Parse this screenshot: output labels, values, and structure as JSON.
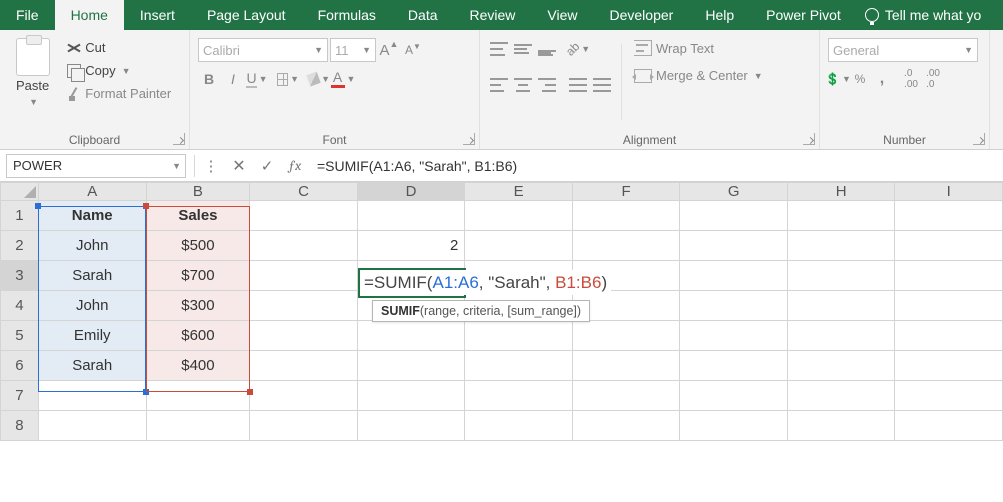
{
  "menu": {
    "file": "File",
    "home": "Home",
    "insert": "Insert",
    "page_layout": "Page Layout",
    "formulas": "Formulas",
    "data": "Data",
    "review": "Review",
    "view": "View",
    "developer": "Developer",
    "help": "Help",
    "power_pivot": "Power Pivot",
    "tell_me": "Tell me what yo"
  },
  "ribbon": {
    "clipboard": {
      "paste": "Paste",
      "cut": "Cut",
      "copy": "Copy",
      "format_painter": "Format Painter",
      "label": "Clipboard"
    },
    "font": {
      "name": "Calibri",
      "size": "11",
      "label": "Font",
      "bold": "B",
      "italic": "I",
      "underline": "U",
      "fontcolor_letter": "A",
      "grow": "A",
      "shrink": "A"
    },
    "alignment": {
      "wrap": "Wrap Text",
      "merge": "Merge & Center",
      "label": "Alignment"
    },
    "number": {
      "format": "General",
      "label": "Number",
      "percent": "%",
      "comma": ","
    }
  },
  "fbar": {
    "namebox": "POWER",
    "formula": "=SUMIF(A1:A6, \"Sarah\", B1:B6)"
  },
  "columns": [
    "A",
    "B",
    "C",
    "D",
    "E",
    "F",
    "G",
    "H",
    "I"
  ],
  "rows": [
    "1",
    "2",
    "3",
    "4",
    "5",
    "6",
    "7",
    "8"
  ],
  "cells": {
    "A1": "Name",
    "B1": "Sales",
    "A2": "John",
    "B2": "$500",
    "A3": "Sarah",
    "B3": "$700",
    "A4": "John",
    "B4": "$300",
    "A5": "Emily",
    "B5": "$600",
    "A6": "Sarah",
    "B6": "$400",
    "D2": "2"
  },
  "edit_formula": {
    "prefix": "=SUMIF(",
    "range1": "A1:A6",
    "mid": ", \"Sarah\", ",
    "range2": "B1:B6",
    "suffix": ")"
  },
  "tooltip": {
    "func": "SUMIF",
    "sig": "(range, criteria, [sum_range])"
  }
}
